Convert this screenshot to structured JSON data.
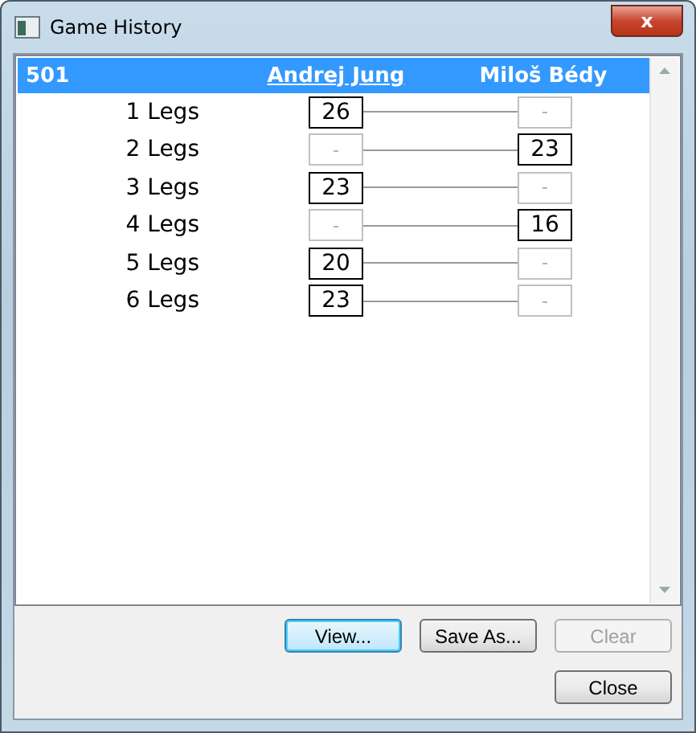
{
  "window": {
    "title": "Game History",
    "close_label": "x"
  },
  "header": {
    "game": "501",
    "players": [
      {
        "name": "Andrej Jung",
        "selected": true
      },
      {
        "name": "Miloš Bédy",
        "selected": false
      }
    ]
  },
  "legs": [
    {
      "label": "1 Legs",
      "scores": [
        {
          "text": "26",
          "won": true
        },
        {
          "text": "-",
          "won": false
        }
      ]
    },
    {
      "label": "2 Legs",
      "scores": [
        {
          "text": "-",
          "won": false
        },
        {
          "text": "23",
          "won": true
        }
      ]
    },
    {
      "label": "3 Legs",
      "scores": [
        {
          "text": "23",
          "won": true
        },
        {
          "text": "-",
          "won": false
        }
      ]
    },
    {
      "label": "4 Legs",
      "scores": [
        {
          "text": "-",
          "won": false
        },
        {
          "text": "16",
          "won": true
        }
      ]
    },
    {
      "label": "5 Legs",
      "scores": [
        {
          "text": "20",
          "won": true
        },
        {
          "text": "-",
          "won": false
        }
      ]
    },
    {
      "label": "6 Legs",
      "scores": [
        {
          "text": "23",
          "won": true
        },
        {
          "text": "-",
          "won": false
        }
      ]
    }
  ],
  "buttons": [
    {
      "label": "View...",
      "disabled": false,
      "default": true
    },
    {
      "label": "Save As...",
      "disabled": false,
      "default": false
    },
    {
      "label": "Clear",
      "disabled": true,
      "default": false
    }
  ],
  "close_button": {
    "label": "Close",
    "disabled": false
  }
}
